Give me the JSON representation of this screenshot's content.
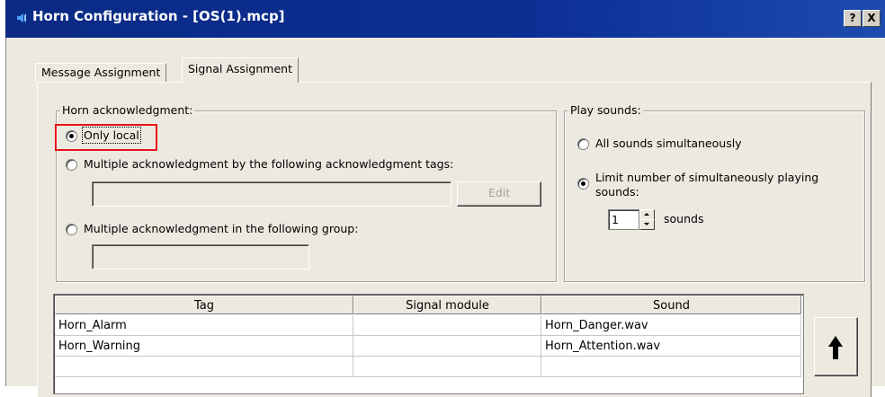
{
  "window": {
    "title": "Horn Configuration - [OS(1).mcp]",
    "help_button": "?",
    "close_button": "X"
  },
  "tabs": [
    {
      "label": "Message Assignment",
      "active": false
    },
    {
      "label": "Signal Assignment",
      "active": true
    }
  ],
  "horn_ack": {
    "legend": "Horn acknowledgment:",
    "options": [
      {
        "label": "Only local",
        "checked": true
      },
      {
        "label": "Multiple acknowledgment by the following acknowledgment tags:",
        "checked": false
      },
      {
        "label": "Multiple acknowledgment in the following group:",
        "checked": false
      }
    ],
    "tags_field_value": "",
    "group_field_value": "",
    "edit_button": "Edit"
  },
  "play_sounds": {
    "legend": "Play sounds:",
    "options": [
      {
        "label": "All sounds simultaneously",
        "checked": false
      },
      {
        "label": "Limit number of simultaneously playing sounds:",
        "checked": true
      }
    ],
    "limit_value": "1",
    "unit_label": "sounds"
  },
  "table": {
    "columns": [
      "Tag",
      "Signal module",
      "Sound"
    ],
    "rows": [
      {
        "tag": "Horn_Alarm",
        "signal_module": "",
        "sound": "Horn_Danger.wav"
      },
      {
        "tag": "Horn_Warning",
        "signal_module": "",
        "sound": "Horn_Attention.wav"
      },
      {
        "tag": "",
        "signal_module": "",
        "sound": ""
      }
    ]
  },
  "up_button_icon": "arrow-up-icon",
  "colors": {
    "titlebar": "#0a2a84",
    "highlight": "#e8141b",
    "dialog_bg": "#ece9e0"
  }
}
